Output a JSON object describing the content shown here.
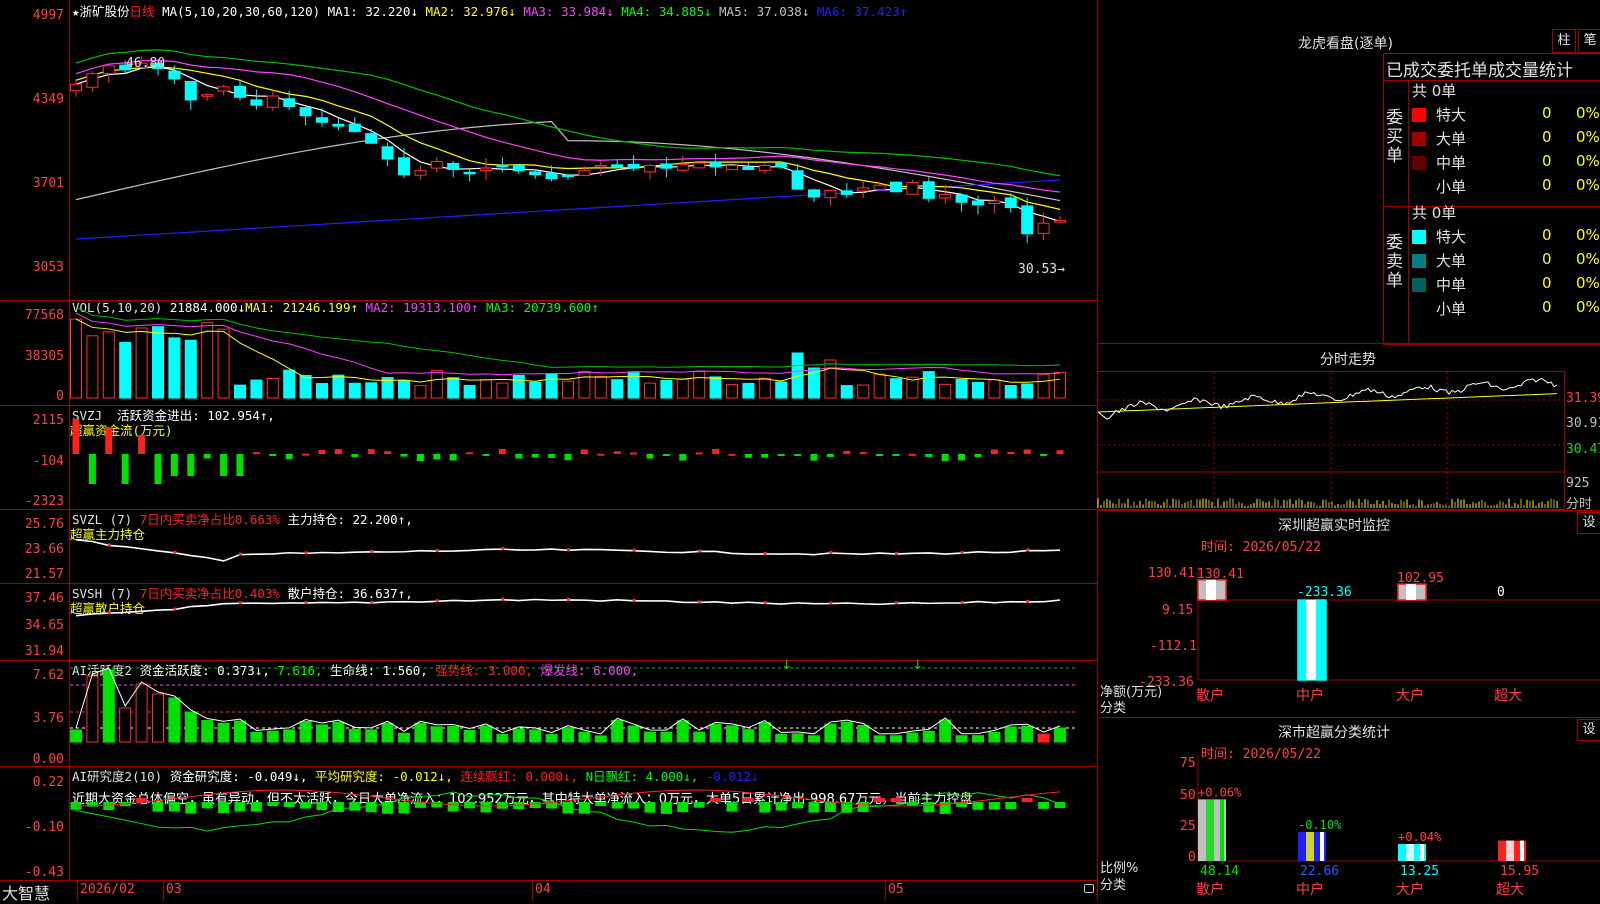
{
  "main": {
    "stock_name": "★浙矿股份",
    "period": "日线",
    "ma_params": "MA(5,10,20,30,60,120)",
    "ma": [
      {
        "label": "MA1: 32.220↓",
        "color": "#ffffff"
      },
      {
        "label": "MA2: 32.976↓",
        "color": "#ffff00"
      },
      {
        "label": "MA3: 33.984↓",
        "color": "#ff40ff"
      },
      {
        "label": "MA4: 34.885↓",
        "color": "#00ff00"
      },
      {
        "label": "MA5: 37.038↓",
        "color": "#c0c0c0"
      },
      {
        "label": "MA6: 37.423↑",
        "color": "#2020ff"
      }
    ],
    "y_ticks": [
      "4997",
      "4349",
      "3701",
      "3053"
    ],
    "high_mark": "46.80",
    "low_mark": "30.53→",
    "y_range": [
      28.5,
      50.0
    ]
  },
  "vol": {
    "header_label": "VOL(5,10,20)",
    "value": "21884.000↓",
    "ma": [
      {
        "label": "MA1: 21246.199↑",
        "color": "#ffff00"
      },
      {
        "label": "MA2: 19313.100↑",
        "color": "#ff40ff"
      },
      {
        "label": "MA3: 20739.600↑",
        "color": "#00ff00"
      }
    ],
    "y_ticks": [
      "77568",
      "38305",
      "0"
    ]
  },
  "svzj": {
    "header_label": "SVZJ",
    "header_value": "活跃资金进出: 102.954↑,",
    "subtitle": "超赢资金流(万元)",
    "y_ticks": [
      "2115",
      "-104",
      "-2323"
    ]
  },
  "svzl": {
    "header_label": "SVZL (7)",
    "header_red": "7日内买卖净占比0.663%",
    "header_value": "主力持仓: 22.200↑,",
    "subtitle": "超赢主力持仓",
    "y_ticks": [
      "25.76",
      "23.66",
      "21.57"
    ]
  },
  "svsh": {
    "header_label": "SVSH (7)",
    "header_red": "7日内买卖净占比0.403%",
    "header_value": "散户持仓: 36.637↑,",
    "subtitle": "超赢散户持仓",
    "y_ticks": [
      "37.46",
      "34.65",
      "31.94"
    ]
  },
  "ai1": {
    "header_label": "AI活跃度2",
    "items": [
      {
        "label": "资金活跃度: 0.373↓,",
        "color": "#ffffff"
      },
      {
        "label": "7.616,",
        "color": "#00ff00"
      },
      {
        "label": "生命线: 1.560,",
        "color": "#ffffff"
      },
      {
        "label": "强势线: 3.000,",
        "color": "#ff2020"
      },
      {
        "label": "爆发线: 6.000,",
        "color": "#ff40ff"
      }
    ],
    "y_ticks": [
      "7.62",
      "3.76",
      "0.00"
    ]
  },
  "ai2": {
    "header_label": "AI研究度2(10)",
    "items": [
      {
        "label": "资金研究度: -0.049↓,",
        "color": "#ffffff"
      },
      {
        "label": "平均研究度: -0.012↓,",
        "color": "#ffff00"
      },
      {
        "label": "连续飘红: 0.000↓,",
        "color": "#ff2020"
      },
      {
        "label": "N日飘红: 4.000↓,",
        "color": "#00ff00"
      },
      {
        "label": "-0.012↓",
        "color": "#2020ff"
      }
    ],
    "comment": "近期大资金总体偏空，虽有异动，但不太活跃，今日大单净流入：102.952万元，其中特大单净流入：0万元，大单5日累计净出-998.67万元，当前主力控盘",
    "y_ticks": [
      "0.22",
      "-0.10",
      "-0.43"
    ]
  },
  "bottom_axis": {
    "brand": "大智慧",
    "labels": [
      "2026/02",
      "03",
      "04",
      "05"
    ]
  },
  "dragon": {
    "title": "龙虎看盘(逐单)",
    "btn_zhu": "柱",
    "btn_bi": "笔",
    "header": "已成交委托单成交量统计",
    "buy": {
      "side_label": "委买单",
      "total": "共 0单",
      "rows": [
        {
          "label": "特大",
          "count": "0",
          "pct": "0%",
          "color": "#ff0000"
        },
        {
          "label": "大单",
          "count": "0",
          "pct": "0%",
          "color": "#a00000"
        },
        {
          "label": "中单",
          "count": "0",
          "pct": "0%",
          "color": "#600000"
        },
        {
          "label": "小单",
          "count": "0",
          "pct": "0%",
          "color": "#000000"
        }
      ]
    },
    "sell": {
      "side_label": "委卖单",
      "total": "共 0单",
      "rows": [
        {
          "label": "特大",
          "count": "0",
          "pct": "0%",
          "color": "#00ffff"
        },
        {
          "label": "大单",
          "count": "0",
          "pct": "0%",
          "color": "#008080"
        },
        {
          "label": "中单",
          "count": "0",
          "pct": "0%",
          "color": "#006060"
        },
        {
          "label": "小单",
          "count": "0",
          "pct": "0%",
          "color": "#000000"
        }
      ]
    }
  },
  "intraday": {
    "title": "分时走势",
    "y_labels": [
      "31.39",
      "30.91",
      "30.47"
    ],
    "vol_label": "925",
    "vol_unit": "分时"
  },
  "monitor": {
    "title": "深圳超赢实时监控",
    "btn_set": "设",
    "time": "时间: 2026/05/22",
    "y_ticks": [
      "130.41",
      "9.15",
      "-112.1",
      "-233.36"
    ],
    "y_unit_1": "净额(万元)",
    "y_unit_2": "分类",
    "categories": [
      "散户",
      "中户",
      "大户",
      "超大"
    ],
    "values": [
      130.41,
      -233.36,
      102.95,
      0
    ],
    "value_labels": [
      "130.41",
      "-233.36",
      "102.95",
      "0"
    ]
  },
  "classify": {
    "title": "深市超赢分类统计",
    "btn_set": "设",
    "time": "时间: 2026/05/22",
    "y_ticks": [
      "75",
      "50",
      "25",
      "0"
    ],
    "y_unit_1": "比例%",
    "y_unit_2": "分类",
    "categories": [
      "散户",
      "中户",
      "大户",
      "超大"
    ],
    "values": [
      48.14,
      22.66,
      13.25,
      15.95
    ],
    "value_labels": [
      "48.14",
      "22.66",
      "13.25",
      "15.95"
    ],
    "change_labels": [
      "+0.06%",
      "-0.10%",
      "+0.04%",
      ""
    ]
  },
  "chart_data": {
    "type": "candlestick",
    "price_axis_ticks": [
      "4997",
      "4349",
      "3701",
      "3053"
    ],
    "high": 46.8,
    "low": 30.53,
    "ma_last": {
      "MA1": 32.22,
      "MA2": 32.976,
      "MA3": 33.984,
      "MA4": 34.885,
      "MA5": 37.038,
      "MA6": 37.423
    },
    "monitor_net_amount": {
      "散户": 130.41,
      "中户": -233.36,
      "大户": 102.95,
      "超大": 0
    },
    "classification_pct": {
      "散户": 48.14,
      "中户": 22.66,
      "大户": 13.25,
      "超大": 15.95
    }
  }
}
